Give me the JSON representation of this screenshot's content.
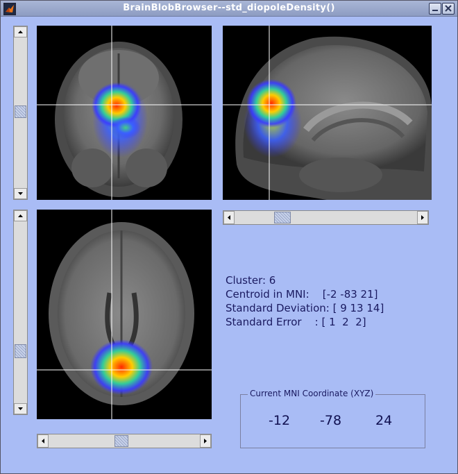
{
  "window": {
    "title": "BrainBlobBrowser--std_diopoleDensity()",
    "controls": [
      "minimize-icon",
      "close-icon"
    ]
  },
  "views": [
    "coronal",
    "sagittal",
    "axial"
  ],
  "info": {
    "cluster": "Cluster: 6",
    "centroid": "Centroid in MNI:    [-2 -83 21]",
    "std_dev": "Standard Deviation: [ 9 13 14]",
    "std_err": "Standard Error    : [ 1  2  2]"
  },
  "coordinate_panel": {
    "title": "Current MNI Coordinate (XYZ)",
    "x": "-12",
    "y": "-78",
    "z": "24"
  },
  "sliders": {
    "coronal_vertical": 0.49,
    "sagittal_horizontal": 0.24,
    "axial_vertical": 0.73,
    "axial_horizontal": 0.48
  },
  "colors": {
    "background": "#a9bcf5",
    "blob_hot": "#ff2a00",
    "blob_cool": "#3a3aff",
    "crosshair": "#ffffff"
  }
}
